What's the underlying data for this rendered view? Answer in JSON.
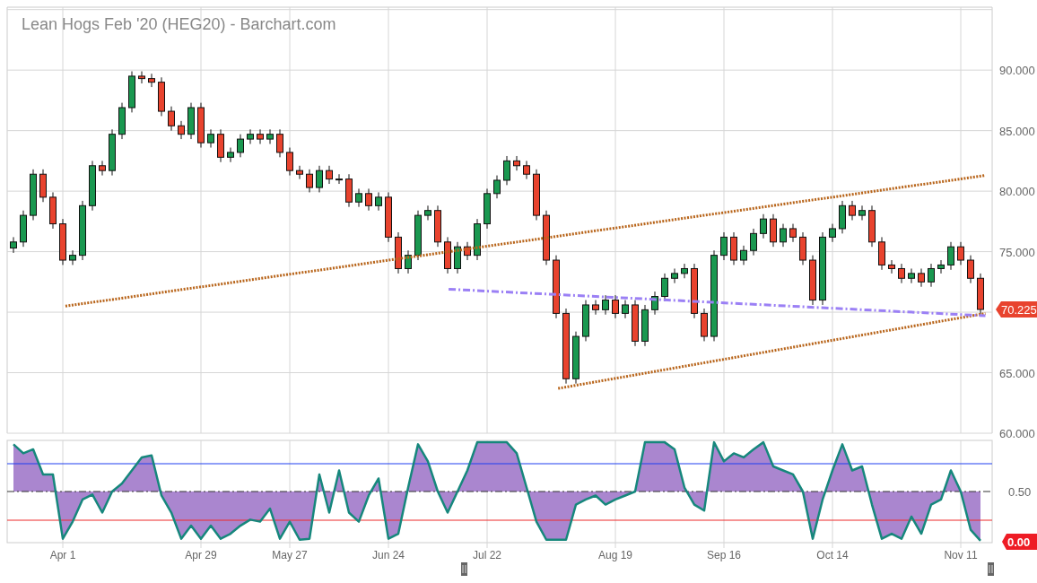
{
  "title": "Lean Hogs Feb '20 (HEG20) - Barchart.com",
  "price_panel": {
    "last_price": "70.225",
    "chart_data": {
      "type": "candlestick",
      "grid": true,
      "yticks": [
        {
          "value": 60,
          "label": "60.000"
        },
        {
          "value": 65,
          "label": "65.000"
        },
        {
          "value": 75,
          "label": "75.000"
        },
        {
          "value": 80,
          "label": "80.000"
        },
        {
          "value": 85,
          "label": "85.000"
        },
        {
          "value": 90,
          "label": "90.000"
        }
      ],
      "ylim": [
        60,
        95.2
      ],
      "categories": [
        null,
        null,
        null,
        null,
        null,
        null,
        null,
        null,
        null,
        null,
        null,
        null,
        null,
        null,
        null,
        null,
        null,
        null,
        null,
        null,
        null,
        null,
        null,
        null,
        null,
        null,
        null,
        null,
        null,
        null,
        null,
        null,
        null,
        null,
        null,
        null,
        null,
        null,
        null,
        null,
        null,
        null,
        null,
        null,
        null,
        null,
        null,
        null,
        null,
        null,
        null,
        null,
        null,
        null,
        null,
        null,
        null,
        null,
        null,
        null,
        null,
        null,
        null,
        null,
        null,
        null,
        null,
        null,
        null,
        null,
        null,
        null,
        null,
        null,
        null,
        null,
        null,
        null,
        null,
        null,
        null,
        null,
        null,
        null,
        null,
        null,
        null,
        null,
        null,
        null,
        null,
        null,
        null,
        null,
        null,
        null,
        null,
        null,
        null
      ],
      "ohlc": [
        [
          75.3,
          76.2,
          74.9,
          75.8
        ],
        [
          75.8,
          78.4,
          75.4,
          78
        ],
        [
          78,
          81.8,
          77.6,
          81.4
        ],
        [
          81.4,
          81.8,
          79.1,
          79.5
        ],
        [
          79.5,
          79.9,
          76.9,
          77.3
        ],
        [
          77.3,
          77.7,
          73.9,
          74.3
        ],
        [
          74.3,
          75.1,
          73.9,
          74.7
        ],
        [
          74.7,
          79.2,
          74.3,
          78.8
        ],
        [
          78.8,
          82.5,
          78.4,
          82.1
        ],
        [
          82.1,
          82.5,
          81.3,
          81.7
        ],
        [
          81.7,
          85.1,
          81.3,
          84.7
        ],
        [
          84.7,
          87.3,
          84.3,
          86.9
        ],
        [
          86.9,
          89.9,
          86.5,
          89.5
        ],
        [
          89.5,
          89.9,
          88.9,
          89.3
        ],
        [
          89.3,
          89.7,
          88.6,
          89
        ],
        [
          89,
          89.4,
          86.2,
          86.6
        ],
        [
          86.6,
          87,
          85,
          85.4
        ],
        [
          85.4,
          85.8,
          84.3,
          84.7
        ],
        [
          84.7,
          87.3,
          84.3,
          86.9
        ],
        [
          86.9,
          87.3,
          83.6,
          84
        ],
        [
          84,
          85.1,
          83.6,
          84.7
        ],
        [
          84.7,
          85.1,
          82.4,
          82.8
        ],
        [
          82.8,
          83.6,
          82.4,
          83.2
        ],
        [
          83.2,
          84.7,
          82.8,
          84.3
        ],
        [
          84.3,
          85.1,
          83.9,
          84.7
        ],
        [
          84.7,
          85.1,
          83.9,
          84.3
        ],
        [
          84.3,
          85.1,
          83.9,
          84.7
        ],
        [
          84.7,
          85.1,
          82.8,
          83.2
        ],
        [
          83.2,
          83.6,
          81.3,
          81.7
        ],
        [
          81.7,
          82.1,
          81,
          81.4
        ],
        [
          81.4,
          81.8,
          79.9,
          80.3
        ],
        [
          80.3,
          82.1,
          79.9,
          81.7
        ],
        [
          81.7,
          82.1,
          80.6,
          81
        ],
        [
          81,
          81.4,
          80.6,
          81
        ],
        [
          81,
          81.4,
          78.7,
          79.1
        ],
        [
          79.1,
          80.2,
          78.7,
          79.8
        ],
        [
          79.8,
          80.2,
          78.4,
          78.8
        ],
        [
          78.8,
          79.9,
          78.4,
          79.5
        ],
        [
          79.5,
          79.9,
          75.8,
          76.2
        ],
        [
          76.2,
          76.6,
          73.2,
          73.6
        ],
        [
          73.6,
          75.1,
          73.2,
          74.7
        ],
        [
          74.7,
          78.4,
          74.3,
          78
        ],
        [
          78,
          78.8,
          77.6,
          78.4
        ],
        [
          78.4,
          78.8,
          75.4,
          75.8
        ],
        [
          75.8,
          76.2,
          73.2,
          73.6
        ],
        [
          73.6,
          75.8,
          73.2,
          75.4
        ],
        [
          75.4,
          75.8,
          74.3,
          74.7
        ],
        [
          74.7,
          77.7,
          74.3,
          77.3
        ],
        [
          77.3,
          80.2,
          76.9,
          79.8
        ],
        [
          79.8,
          81.3,
          79.4,
          80.9
        ],
        [
          80.9,
          82.9,
          80.5,
          82.5
        ],
        [
          82.5,
          82.9,
          81.7,
          82.1
        ],
        [
          82.1,
          82.5,
          81,
          81.4
        ],
        [
          81.4,
          81.8,
          77.6,
          78
        ],
        [
          78,
          78.4,
          73.9,
          74.3
        ],
        [
          74.3,
          74.7,
          69.5,
          69.9
        ],
        [
          69.9,
          70.3,
          64.1,
          64.5
        ],
        [
          64.5,
          68.4,
          64.1,
          68
        ],
        [
          68,
          71,
          67.6,
          70.6
        ],
        [
          70.6,
          71,
          69.8,
          70.2
        ],
        [
          70.2,
          71.4,
          69.8,
          71
        ],
        [
          71,
          71.4,
          69.5,
          69.9
        ],
        [
          69.9,
          71,
          69.5,
          70.6
        ],
        [
          70.6,
          71,
          67.2,
          67.6
        ],
        [
          67.6,
          70.6,
          67.2,
          70.2
        ],
        [
          70.2,
          71.7,
          69.8,
          71.3
        ],
        [
          71.3,
          73.2,
          70.9,
          72.8
        ],
        [
          72.8,
          73.6,
          72.4,
          73.2
        ],
        [
          73.2,
          74,
          72.8,
          73.6
        ],
        [
          73.6,
          74,
          69.5,
          69.9
        ],
        [
          69.9,
          70.3,
          67.6,
          68
        ],
        [
          68,
          75.1,
          67.6,
          74.7
        ],
        [
          74.7,
          76.6,
          74.3,
          76.2
        ],
        [
          76.2,
          76.6,
          73.9,
          74.3
        ],
        [
          74.3,
          75.5,
          73.9,
          75.1
        ],
        [
          75.1,
          76.9,
          74.7,
          76.5
        ],
        [
          76.5,
          78.1,
          76.1,
          77.7
        ],
        [
          77.7,
          78.1,
          75.4,
          75.8
        ],
        [
          75.8,
          77.3,
          75.4,
          76.9
        ],
        [
          76.9,
          77.3,
          75.8,
          76.2
        ],
        [
          76.2,
          76.6,
          73.9,
          74.3
        ],
        [
          74.3,
          74.7,
          70.6,
          71
        ],
        [
          71,
          76.6,
          70.6,
          76.2
        ],
        [
          76.2,
          77.3,
          75.8,
          76.9
        ],
        [
          76.9,
          79.2,
          76.5,
          78.8
        ],
        [
          78.8,
          79.2,
          77.6,
          78
        ],
        [
          78,
          78.8,
          77.6,
          78.4
        ],
        [
          78.4,
          78.8,
          75.4,
          75.8
        ],
        [
          75.8,
          76.2,
          73.5,
          73.9
        ],
        [
          73.9,
          74.3,
          73.2,
          73.6
        ],
        [
          73.6,
          74,
          72.4,
          72.8
        ],
        [
          72.8,
          73.6,
          72.4,
          73.2
        ],
        [
          73.2,
          73.6,
          72.1,
          72.5
        ],
        [
          72.5,
          74,
          72.1,
          73.6
        ],
        [
          73.6,
          74.3,
          73.2,
          73.9
        ],
        [
          73.9,
          75.8,
          73.5,
          75.4
        ],
        [
          75.4,
          75.8,
          73.9,
          74.3
        ],
        [
          74.3,
          74.7,
          72.4,
          72.8
        ],
        [
          72.8,
          73.2,
          69.8,
          70.225
        ]
      ]
    }
  },
  "indicator_panel": {
    "chart_data": {
      "type": "line",
      "ylim": [
        0,
        1
      ],
      "yticks": [
        {
          "value": 0,
          "label": "0.00"
        },
        {
          "value": 0.5,
          "label": "0.50"
        }
      ],
      "categories": [
        null,
        null,
        null,
        null,
        null,
        "Apr 1",
        null,
        null,
        null,
        null,
        null,
        null,
        null,
        null,
        null,
        null,
        null,
        null,
        null,
        "Apr 29",
        null,
        null,
        null,
        null,
        null,
        null,
        null,
        null,
        "May 27",
        null,
        null,
        null,
        null,
        null,
        null,
        null,
        null,
        null,
        "Jun 24",
        null,
        null,
        null,
        null,
        null,
        null,
        null,
        null,
        null,
        "Jul 22",
        null,
        null,
        null,
        null,
        null,
        null,
        null,
        null,
        null,
        null,
        null,
        null,
        "Aug 19",
        null,
        null,
        null,
        null,
        null,
        null,
        null,
        null,
        null,
        null,
        "Sep 16",
        null,
        null,
        null,
        null,
        null,
        null,
        null,
        null,
        null,
        null,
        "Oct 14",
        null,
        null,
        null,
        null,
        null,
        null,
        null,
        null,
        null,
        null,
        null,
        null,
        "Nov 11",
        null,
        null
      ],
      "series": [
        {
          "color": "#16877c",
          "values": [
            0.97,
            0.88,
            0.92,
            0.67,
            0.67,
            0.03,
            0.2,
            0.42,
            0.47,
            0.29,
            0.5,
            0.58,
            0.71,
            0.84,
            0.86,
            0.46,
            0.29,
            0.03,
            0.16,
            0.03,
            0.16,
            0.03,
            0.08,
            0.16,
            0.22,
            0.2,
            0.33,
            0.03,
            0.2,
            0.02,
            0.03,
            0.67,
            0.29,
            0.71,
            0.29,
            0.2,
            0.46,
            0.63,
            0.03,
            0.08,
            0.54,
            0.97,
            0.8,
            0.5,
            0.29,
            0.5,
            0.71,
            0.99,
            0.99,
            0.99,
            0.99,
            0.88,
            0.54,
            0.2,
            0.02,
            0.02,
            0.02,
            0.37,
            0.42,
            0.46,
            0.37,
            0.42,
            0.46,
            0.5,
            0.99,
            0.99,
            0.99,
            0.92,
            0.54,
            0.37,
            0.31,
            0.99,
            0.8,
            0.88,
            0.84,
            0.92,
            0.99,
            0.75,
            0.71,
            0.67,
            0.5,
            0.03,
            0.42,
            0.71,
            0.97,
            0.71,
            0.75,
            0.37,
            0.03,
            0.08,
            0.03,
            0.25,
            0.08,
            0.37,
            0.42,
            0.71,
            0.5,
            0.12,
            0.01
          ]
        }
      ]
    }
  }
}
